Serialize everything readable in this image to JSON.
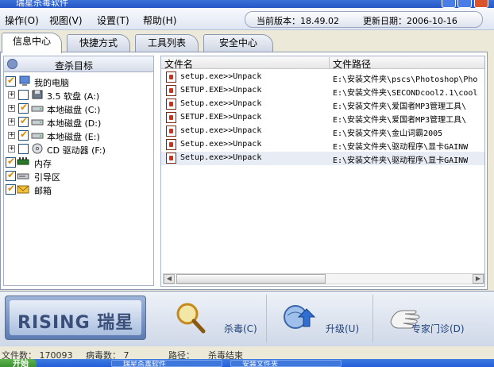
{
  "window": {
    "title": "瑞星杀毒软件"
  },
  "menu": {
    "items": [
      {
        "label": "操作(O)"
      },
      {
        "label": "视图(V)"
      },
      {
        "label": "设置(T)"
      },
      {
        "label": "帮助(H)"
      }
    ],
    "version_label": "当前版本：18.49.02",
    "update_label": "更新日期：2006-10-16"
  },
  "tabs": [
    {
      "label": "信息中心",
      "active": true
    },
    {
      "label": "快捷方式",
      "active": false
    },
    {
      "label": "工具列表",
      "active": false
    },
    {
      "label": "安全中心",
      "active": false
    }
  ],
  "scan_targets": {
    "title": "查杀目标",
    "items": [
      {
        "label": "我的电脑",
        "checked": true,
        "icon": "computer-icon"
      },
      {
        "label": "3.5 软盘 (A:)",
        "checked": false,
        "icon": "floppy-icon"
      },
      {
        "label": "本地磁盘 (C:)",
        "checked": true,
        "icon": "disk-icon"
      },
      {
        "label": "本地磁盘 (D:)",
        "checked": true,
        "icon": "disk-icon"
      },
      {
        "label": "本地磁盘 (E:)",
        "checked": true,
        "icon": "disk-icon"
      },
      {
        "label": "CD 驱动器 (F:)",
        "checked": false,
        "icon": "cd-icon"
      },
      {
        "label": "内存",
        "checked": true,
        "icon": "memory-icon"
      },
      {
        "label": "引导区",
        "checked": true,
        "icon": "boot-sector-icon"
      },
      {
        "label": "邮箱",
        "checked": true,
        "icon": "mailbox-icon"
      }
    ]
  },
  "file_list": {
    "columns": [
      "文件名",
      "文件路径"
    ],
    "rows": [
      {
        "name": "setup.exe>>Unpack",
        "path": "E:\\安装文件夹\\pscs\\Photoshop\\Pho"
      },
      {
        "name": "SETUP.EXE>>Unpack",
        "path": "E:\\安装文件夹\\SECONDcool2.1\\cool"
      },
      {
        "name": "Setup.exe>>Unpack",
        "path": "E:\\安装文件夹\\爱国者MP3管理工具\\"
      },
      {
        "name": "SETUP.EXE>>Unpack",
        "path": "E:\\安装文件夹\\爱国者MP3管理工具\\"
      },
      {
        "name": "setup.exe>>Unpack",
        "path": "E:\\安装文件夹\\金山词霸2005"
      },
      {
        "name": "Setup.exe>>Unpack",
        "path": "E:\\安装文件夹\\驱动程序\\显卡GAINW"
      },
      {
        "name": "Setup.exe>>Unpack",
        "path": "E:\\安装文件夹\\驱动程序\\显卡GAINW"
      }
    ]
  },
  "toolbar": {
    "logo_text": "RISING 瑞星",
    "kill_label": "杀毒(C)",
    "upgrade_label": "升级(U)",
    "expert_label": "专家门诊(D)"
  },
  "status": {
    "file_count": "文件数： 170093",
    "virus_count": "病毒数： 7",
    "path_label": "路径：",
    "path_value": "杀毒结束"
  },
  "taskbar": {
    "start_label": "开始",
    "tasks": [
      "瑞星杀毒软件",
      "安装文件夹"
    ]
  },
  "colors": {
    "accent": "#23437a",
    "check": "#e08a00",
    "titlebar": "#2657c5"
  }
}
